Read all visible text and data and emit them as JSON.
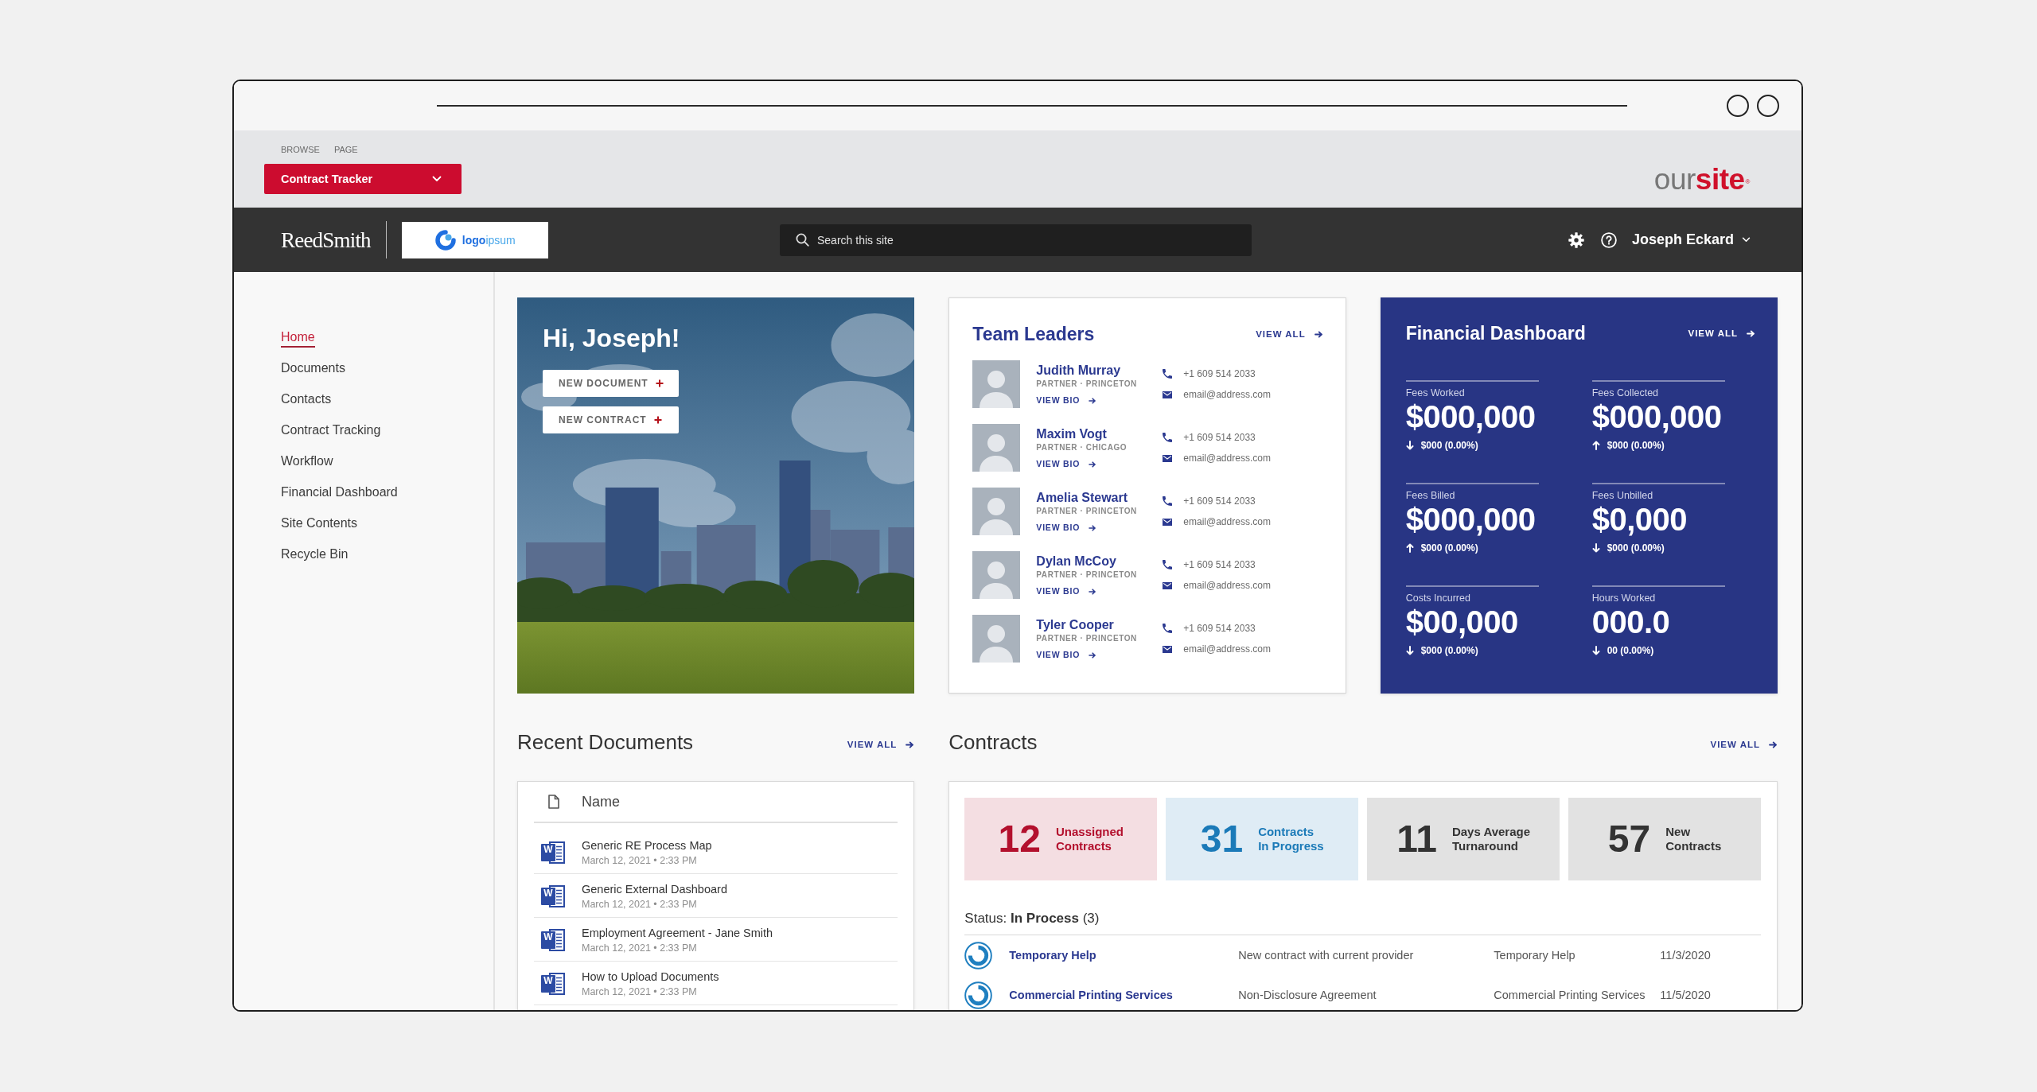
{
  "ribbon": {
    "tabs": [
      {
        "label": "BROWSE",
        "selected": false
      },
      {
        "label": "PAGE",
        "selected": false
      }
    ],
    "site_menu": {
      "label": "Contract Tracker"
    },
    "site_logo": "our**site**$^{®}$"
  },
  "header": {
    "brand": "ReedSmith",
    "partner_logo": "**logo**ipsum",
    "search": {
      "placeholder": "Search this site"
    },
    "user": {
      "name": "Joseph Eckard"
    }
  },
  "sidebar": {
    "items": [
      {
        "label": "Home",
        "selected": true
      },
      {
        "label": "Documents",
        "selected": false
      },
      {
        "label": "Contacts",
        "selected": false
      },
      {
        "label": "Contract Tracking",
        "selected": false
      },
      {
        "label": "Workflow",
        "selected": false
      },
      {
        "label": "Financial Dashboard",
        "selected": false
      },
      {
        "label": "Site Contents",
        "selected": false
      },
      {
        "label": "Recycle Bin",
        "selected": false
      }
    ]
  },
  "hero": {
    "greeting": "Hi, Joseph!",
    "buttons": [
      {
        "label": "NEW DOCUMENT"
      },
      {
        "label": "NEW CONTRACT"
      }
    ]
  },
  "team_leaders": {
    "title": "Team Leaders",
    "view_all": "VIEW ALL",
    "people": [
      {
        "name": "Judith Murray",
        "role": "PARTNER · PRINCETON",
        "link": "VIEW BIO",
        "phone": "+1 609 514 2033",
        "email": "email@address.com"
      },
      {
        "name": "Maxim Vogt",
        "role": "PARTNER · CHICAGO",
        "link": "VIEW BIO",
        "phone": "+1 609 514 2033",
        "email": "email@address.com"
      },
      {
        "name": "Amelia Stewart",
        "role": "PARTNER · PRINCETON",
        "link": "VIEW BIO",
        "phone": "+1 609 514 2033",
        "email": "email@address.com"
      },
      {
        "name": "Dylan McCoy",
        "role": "PARTNER · PRINCETON",
        "link": "VIEW BIO",
        "phone": "+1 609 514 2033",
        "email": "email@address.com"
      },
      {
        "name": "Tyler Cooper",
        "role": "PARTNER · PRINCETON",
        "link": "VIEW BIO",
        "phone": "+1 609 514 2033",
        "email": "email@address.com"
      }
    ]
  },
  "financial_dashboard": {
    "title": "Financial Dashboard",
    "view_all": "VIEW ALL",
    "metrics": [
      {
        "label": "Fees Worked",
        "value": "$000,000",
        "increase": false,
        "change": "$000 (0.00%)"
      },
      {
        "label": "Fees Collected",
        "value": "$000,000",
        "increase": true,
        "change": "$000 (0.00%)"
      },
      {
        "label": "Fees Billed",
        "value": "$000,000",
        "increase": true,
        "change": "$000 (0.00%)"
      },
      {
        "label": "Fees Unbilled",
        "value": "$0,000",
        "increase": false,
        "change": "$000 (0.00%)"
      },
      {
        "label": "Costs Incurred",
        "value": "$00,000",
        "increase": false,
        "change": "$000 (0.00%)"
      },
      {
        "label": "Hours Worked",
        "value": "000.0",
        "increase": false,
        "change": "00 (0.00%)"
      }
    ]
  },
  "recent_documents": {
    "title": "Recent Documents",
    "view_all": "VIEW ALL",
    "column": "Name",
    "documents": [
      {
        "icon_letter": "W",
        "name": "Generic RE Process Map",
        "date": "March 12, 2021 • 2:33 PM"
      },
      {
        "icon_letter": "W",
        "name": "Generic External Dashboard",
        "date": "March 12, 2021 • 2:33 PM"
      },
      {
        "icon_letter": "W",
        "name": "Employment Agreement - Jane Smith",
        "date": "March 12, 2021 • 2:33 PM"
      },
      {
        "icon_letter": "W",
        "name": "How to Upload Documents",
        "date": "March 12, 2021 • 2:33 PM"
      }
    ]
  },
  "contracts": {
    "title": "Contracts",
    "view_all": "VIEW ALL",
    "stats": [
      {
        "count": "12",
        "label": "Unassigned\nContracts",
        "color": "#b3102d"
      },
      {
        "count": "31",
        "label": "Contracts\nIn Progress",
        "color": "#1b7ab8"
      },
      {
        "count": "11",
        "label": "Days Average\nTurnaround",
        "color": "#333333"
      },
      {
        "count": "57",
        "label": "New\nContracts",
        "color": "#333333"
      }
    ],
    "status": "Status: **In Process** (3)",
    "rows": [
      {
        "title": "Temporary Help",
        "description": "New contract with current provider",
        "category": "Temporary Help",
        "date": "11/3/2020"
      },
      {
        "title": "Commercial Printing Services",
        "description": "Non-Disclosure Agreement",
        "category": "Commercial Printing Services",
        "date": "11/5/2020"
      }
    ]
  }
}
